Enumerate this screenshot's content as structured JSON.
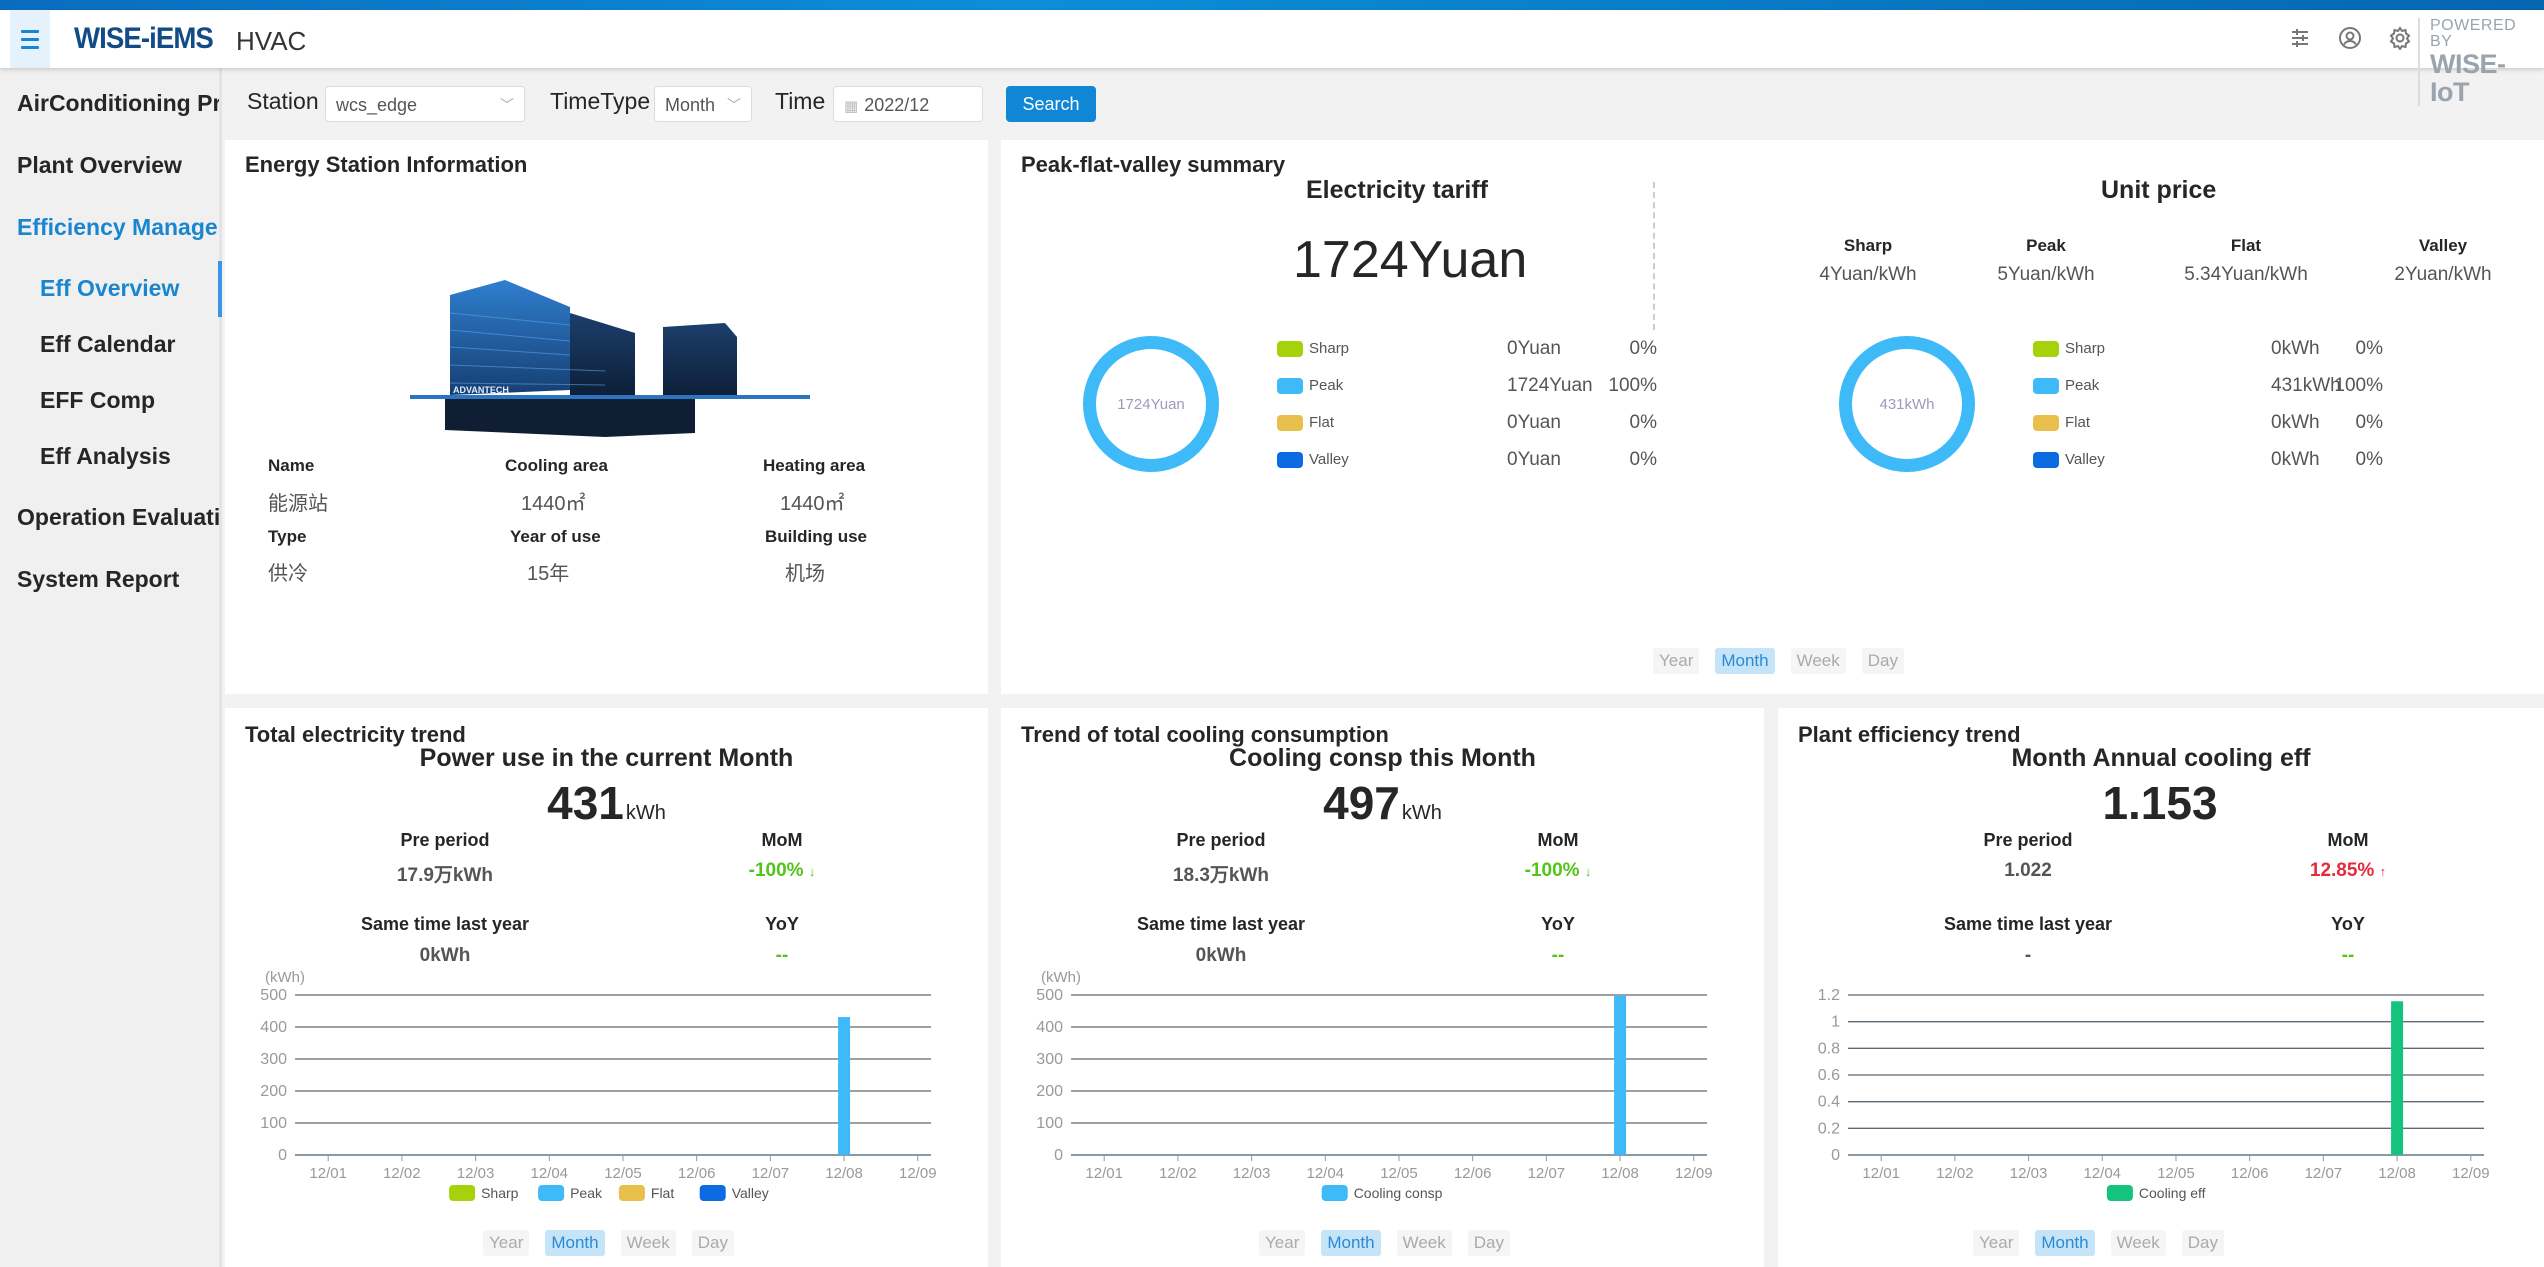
{
  "header": {
    "logo": "WISE-iEMS",
    "app_name": "HVAC",
    "powered_by_line1": "POWERED BY",
    "powered_by_line2": "WISE-IoT",
    "icons": [
      "sliders-icon",
      "user-icon",
      "gear-icon"
    ]
  },
  "sidebar": {
    "items": [
      {
        "label": "AirConditioning Pro",
        "level": 1,
        "active": false
      },
      {
        "label": "Plant Overview",
        "level": 1,
        "active": false
      },
      {
        "label": "Efficiency Manage",
        "level": 1,
        "active": true
      },
      {
        "label": "Eff Overview",
        "level": 2,
        "active": true
      },
      {
        "label": "Eff Calendar",
        "level": 2,
        "active": false
      },
      {
        "label": "EFF Comp",
        "level": 2,
        "active": false
      },
      {
        "label": "Eff Analysis",
        "level": 2,
        "active": false
      },
      {
        "label": "Operation Evaluation",
        "level": 1,
        "active": false
      },
      {
        "label": "System Report",
        "level": 1,
        "active": false
      }
    ]
  },
  "filter": {
    "station_label": "Station",
    "station_value": "wcs_edge",
    "timetype_label": "TimeType",
    "timetype_value": "Month",
    "time_label": "Time",
    "time_value": "2022/12",
    "search_label": "Search"
  },
  "station_info": {
    "title": "Energy Station Information",
    "building_label": "ADVANTECH",
    "fields": [
      {
        "label": "Name",
        "value": "能源站"
      },
      {
        "label": "Cooling area",
        "value": "1440㎡"
      },
      {
        "label": "Heating area",
        "value": "1440㎡"
      },
      {
        "label": "Type",
        "value": "供冷"
      },
      {
        "label": "Year of use",
        "value": "15年"
      },
      {
        "label": "Building use",
        "value": "机场"
      }
    ]
  },
  "pfv": {
    "title": "Peak-flat-valley summary",
    "tariff": {
      "title": "Electricity tariff",
      "total": "1724Yuan",
      "ring_label": "1724Yuan",
      "rows": [
        {
          "name": "Sharp",
          "value": "0Yuan",
          "pct": "0%",
          "color": "#a5d20a"
        },
        {
          "name": "Peak",
          "value": "1724Yuan",
          "pct": "100%",
          "color": "#3ebaf8"
        },
        {
          "name": "Flat",
          "value": "0Yuan",
          "pct": "0%",
          "color": "#eac04c"
        },
        {
          "name": "Valley",
          "value": "0Yuan",
          "pct": "0%",
          "color": "#0b6be0"
        }
      ]
    },
    "unit_price": {
      "title": "Unit price",
      "prices": [
        {
          "name": "Sharp",
          "value": "4Yuan/kWh"
        },
        {
          "name": "Peak",
          "value": "5Yuan/kWh"
        },
        {
          "name": "Flat",
          "value": "5.34Yuan/kWh"
        },
        {
          "name": "Valley",
          "value": "2Yuan/kWh"
        }
      ],
      "ring_label": "431kWh",
      "rows": [
        {
          "name": "Sharp",
          "value": "0kWh",
          "pct": "0%",
          "color": "#a5d20a"
        },
        {
          "name": "Peak",
          "value": "431kWh",
          "pct": "100%",
          "color": "#3ebaf8"
        },
        {
          "name": "Flat",
          "value": "0kWh",
          "pct": "0%",
          "color": "#eac04c"
        },
        {
          "name": "Valley",
          "value": "0kWh",
          "pct": "0%",
          "color": "#0b6be0"
        }
      ]
    },
    "tabs": [
      "Year",
      "Month",
      "Week",
      "Day"
    ],
    "active_tab": "Month"
  },
  "trends": [
    {
      "title": "Total electricity trend",
      "subtitle": "Power use in the current Month",
      "value": "431",
      "unit": "kWh",
      "pre_period_label": "Pre period",
      "pre_period_value": "17.9万kWh",
      "mom_label": "MoM",
      "mom_value": "-100%",
      "mom_dir": "down",
      "last_year_label": "Same time last year",
      "last_year_value": "0kWh",
      "yoy_label": "YoY",
      "yoy_value": "--",
      "tabs": [
        "Year",
        "Month",
        "Week",
        "Day"
      ],
      "active_tab": "Month"
    },
    {
      "title": "Trend of total cooling consumption",
      "subtitle": "Cooling consp this Month",
      "value": "497",
      "unit": "kWh",
      "pre_period_label": "Pre period",
      "pre_period_value": "18.3万kWh",
      "mom_label": "MoM",
      "mom_value": "-100%",
      "mom_dir": "down",
      "last_year_label": "Same time last year",
      "last_year_value": "0kWh",
      "yoy_label": "YoY",
      "yoy_value": "--",
      "tabs": [
        "Year",
        "Month",
        "Week",
        "Day"
      ],
      "active_tab": "Month"
    },
    {
      "title": "Plant efficiency trend",
      "subtitle": "Month Annual cooling eff",
      "value": "1.153",
      "unit": "",
      "pre_period_label": "Pre period",
      "pre_period_value": "1.022",
      "mom_label": "MoM",
      "mom_value": "12.85%",
      "mom_dir": "up",
      "last_year_label": "Same time last year",
      "last_year_value": "-",
      "yoy_label": "YoY",
      "yoy_value": "--",
      "tabs": [
        "Year",
        "Month",
        "Week",
        "Day"
      ],
      "active_tab": "Month"
    }
  ],
  "chart_data": [
    {
      "type": "bar",
      "title": "Total electricity trend",
      "ylabel": "(kWh)",
      "xlabel": "",
      "categories": [
        "12/01",
        "12/02",
        "12/03",
        "12/04",
        "12/05",
        "12/06",
        "12/07",
        "12/08",
        "12/09"
      ],
      "yticks": [
        0,
        100,
        200,
        300,
        400,
        500
      ],
      "ylim": [
        0,
        500
      ],
      "stacked": true,
      "series": [
        {
          "name": "Sharp",
          "color": "#a5d20a",
          "values": [
            0,
            0,
            0,
            0,
            0,
            0,
            0,
            0,
            0
          ]
        },
        {
          "name": "Peak",
          "color": "#3ebaf8",
          "values": [
            0,
            0,
            0,
            0,
            0,
            0,
            0,
            431,
            0
          ]
        },
        {
          "name": "Flat",
          "color": "#eac04c",
          "values": [
            0,
            0,
            0,
            0,
            0,
            0,
            0,
            0,
            0
          ]
        },
        {
          "name": "Valley",
          "color": "#0b6be0",
          "values": [
            0,
            0,
            0,
            0,
            0,
            0,
            0,
            0,
            0
          ]
        }
      ],
      "legend": "bottom",
      "grid": true
    },
    {
      "type": "bar",
      "title": "Trend of total cooling consumption",
      "ylabel": "(kWh)",
      "xlabel": "",
      "categories": [
        "12/01",
        "12/02",
        "12/03",
        "12/04",
        "12/05",
        "12/06",
        "12/07",
        "12/08",
        "12/09"
      ],
      "yticks": [
        0,
        100,
        200,
        300,
        400,
        500
      ],
      "ylim": [
        0,
        500
      ],
      "stacked": false,
      "series": [
        {
          "name": "Cooling consp",
          "color": "#3ebaf8",
          "values": [
            0,
            0,
            0,
            0,
            0,
            0,
            0,
            497,
            0
          ]
        }
      ],
      "legend": "bottom",
      "grid": true
    },
    {
      "type": "bar",
      "title": "Plant efficiency trend",
      "ylabel": "",
      "xlabel": "",
      "categories": [
        "12/01",
        "12/02",
        "12/03",
        "12/04",
        "12/05",
        "12/06",
        "12/07",
        "12/08",
        "12/09"
      ],
      "yticks": [
        0,
        0.2,
        0.4,
        0.6,
        0.8,
        1,
        1.2
      ],
      "ylim": [
        0,
        1.2
      ],
      "stacked": false,
      "series": [
        {
          "name": "Cooling eff",
          "color": "#14c47e",
          "values": [
            0,
            0,
            0,
            0,
            0,
            0,
            0,
            1.153,
            0
          ]
        }
      ],
      "legend": "bottom",
      "grid": true
    }
  ]
}
